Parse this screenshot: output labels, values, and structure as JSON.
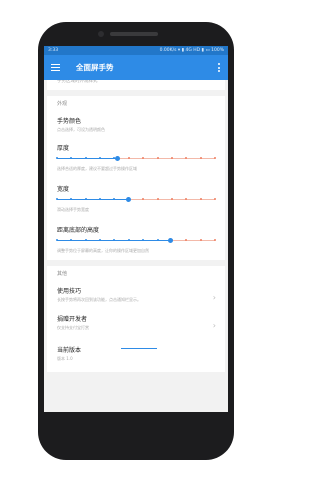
{
  "status": {
    "time": "3:33",
    "right": "0.00K/s ▾ ▮ 4G HD ▮ ▭ 100%"
  },
  "appbar": {
    "title": "全面屏手势"
  },
  "top_cut": "手势区域的外观样式",
  "sections": {
    "appearance": "外观",
    "other": "其他"
  },
  "items": [
    {
      "title": "手势颜色",
      "subtitle": "点击选择，可设为透明颜色"
    },
    {
      "title": "厚度",
      "subtitle": "选择合适的厚度，建议不要超过手势操作区域"
    },
    {
      "title": "宽度",
      "subtitle": "滑动选择手势宽度"
    },
    {
      "title": "距离底部的高度",
      "subtitle": "调整手势位于屏幕的高度，让你的操作区域更加自然"
    }
  ],
  "sliders": {
    "thickness": {
      "value": 0.38,
      "ticks": 12
    },
    "width": {
      "value": 0.45,
      "ticks": 12
    },
    "bottom_height": {
      "value": 0.72,
      "ticks": 12
    }
  },
  "other_items": [
    {
      "title": "使用技巧",
      "subtitle": "长按手势将再次回到该功能，点击通知栏显示。"
    },
    {
      "title": "捐赠开发者",
      "subtitle": "仅支持支付宝打赏"
    },
    {
      "title": "当前版本",
      "subtitle": "版本 1.0"
    }
  ],
  "colors": {
    "accent": "#2e8be6",
    "tick": "#ef8062"
  }
}
